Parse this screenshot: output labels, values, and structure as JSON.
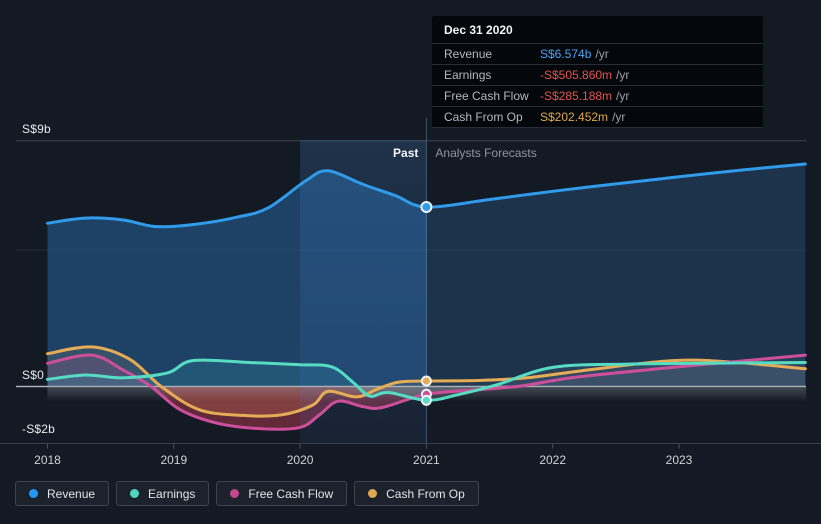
{
  "page": {
    "background": "#141a23"
  },
  "tooltip": {
    "title": "Dec 31 2020",
    "rows": [
      {
        "label": "Revenue",
        "value": "S$6.574b",
        "suffix": "/yr",
        "color": "#4ba3f5"
      },
      {
        "label": "Earnings",
        "value": "-S$505.860m",
        "suffix": "/yr",
        "color": "#e5534e"
      },
      {
        "label": "Free Cash Flow",
        "value": "-S$285.188m",
        "suffix": "/yr",
        "color": "#e5534e"
      },
      {
        "label": "Cash From Op",
        "value": "S$202.452m",
        "suffix": "/yr",
        "color": "#e2a74c"
      }
    ]
  },
  "annotations": {
    "past": "Past",
    "forecast": "Analysts Forecasts"
  },
  "y_axis": [
    {
      "label": "S$9b",
      "value": 9
    },
    {
      "label": "S$0",
      "value": 0
    },
    {
      "label": "-S$2b",
      "value": -2
    }
  ],
  "x_axis": [
    2018,
    2019,
    2020,
    2021,
    2022,
    2023
  ],
  "legend": [
    {
      "label": "Revenue",
      "color": "#2597f3"
    },
    {
      "label": "Earnings",
      "color": "#4fd6c0"
    },
    {
      "label": "Free Cash Flow",
      "color": "#c2478e"
    },
    {
      "label": "Cash From Op",
      "color": "#e0a84f"
    }
  ],
  "chart_data": {
    "type": "area",
    "units": "S$ billions per year",
    "x_range": [
      2018,
      2024
    ],
    "ylim_billions": [
      -2.07,
      9.25
    ],
    "grid_values": [
      9,
      5,
      0
    ],
    "divider_x": 2021,
    "highlight_band": [
      2020,
      2021
    ],
    "marker_x": 2021,
    "series": [
      {
        "name": "Cash From Op",
        "color": "#e6ac55",
        "fill_past": "rgba(228,168,78,0.26)",
        "fill_forecast": "rgba(158,170,182,0.10)",
        "points": [
          [
            2018,
            1.2
          ],
          [
            2018.35,
            1.45
          ],
          [
            2018.65,
            1.0
          ],
          [
            2018.9,
            0
          ],
          [
            2019.2,
            -0.85
          ],
          [
            2019.55,
            -1.06
          ],
          [
            2019.85,
            -1.04
          ],
          [
            2020.1,
            -0.68
          ],
          [
            2020.22,
            -0.18
          ],
          [
            2020.45,
            -0.38
          ],
          [
            2020.62,
            -0.08
          ],
          [
            2020.78,
            0.16
          ],
          [
            2021,
            0.202452
          ],
          [
            2021.4,
            0.22
          ],
          [
            2021.8,
            0.32
          ],
          [
            2022.3,
            0.62
          ],
          [
            2022.95,
            0.95
          ],
          [
            2023.4,
            0.9
          ],
          [
            2024,
            0.65
          ]
        ]
      },
      {
        "name": "Free Cash Flow",
        "color": "#cd4f9b",
        "fill_past": "rgba(206,62,88,0.42)",
        "fill_forecast": "rgba(158,170,182,0.13)",
        "points": [
          [
            2018,
            0.85
          ],
          [
            2018.35,
            1.15
          ],
          [
            2018.6,
            0.6
          ],
          [
            2018.82,
            0
          ],
          [
            2019.05,
            -0.85
          ],
          [
            2019.35,
            -1.35
          ],
          [
            2019.7,
            -1.55
          ],
          [
            2020,
            -1.5
          ],
          [
            2020.15,
            -1.05
          ],
          [
            2020.3,
            -0.54
          ],
          [
            2020.5,
            -0.74
          ],
          [
            2020.65,
            -0.77
          ],
          [
            2021,
            -0.285188
          ],
          [
            2021.4,
            -0.12
          ],
          [
            2021.75,
            0.02
          ],
          [
            2022.2,
            0.35
          ],
          [
            2023,
            0.72
          ],
          [
            2024,
            1.15
          ]
        ]
      },
      {
        "name": "Earnings",
        "color": "#55dcc3",
        "fill_past": "rgba(66,198,176,0.26)",
        "fill_forecast": "rgba(158,170,182,0.20)",
        "points": [
          [
            2018,
            0.26
          ],
          [
            2018.3,
            0.42
          ],
          [
            2018.6,
            0.32
          ],
          [
            2018.95,
            0.5
          ],
          [
            2019.15,
            0.95
          ],
          [
            2019.6,
            0.88
          ],
          [
            2020,
            0.8
          ],
          [
            2020.25,
            0.72
          ],
          [
            2020.42,
            0.15
          ],
          [
            2020.55,
            -0.35
          ],
          [
            2020.7,
            -0.22
          ],
          [
            2021,
            -0.50586
          ],
          [
            2021.25,
            -0.3
          ],
          [
            2021.55,
            0.05
          ],
          [
            2022,
            0.7
          ],
          [
            2022.6,
            0.82
          ],
          [
            2023.2,
            0.85
          ],
          [
            2024,
            0.88
          ]
        ]
      },
      {
        "name": "Revenue",
        "color": "#2f9bea",
        "fill_past": "rgba(38,98,156,0.55)",
        "fill_forecast": "rgba(40,80,124,0.45)",
        "points": [
          [
            2018,
            5.98
          ],
          [
            2018.3,
            6.17
          ],
          [
            2018.6,
            6.1
          ],
          [
            2018.85,
            5.86
          ],
          [
            2019.15,
            5.93
          ],
          [
            2019.5,
            6.2
          ],
          [
            2019.75,
            6.55
          ],
          [
            2020.05,
            7.55
          ],
          [
            2020.22,
            7.9
          ],
          [
            2020.5,
            7.4
          ],
          [
            2020.75,
            7.0
          ],
          [
            2021,
            6.574
          ],
          [
            2021.5,
            6.85
          ],
          [
            2022,
            7.15
          ],
          [
            2022.5,
            7.42
          ],
          [
            2023,
            7.68
          ],
          [
            2023.5,
            7.93
          ],
          [
            2024,
            8.15
          ]
        ]
      }
    ]
  }
}
